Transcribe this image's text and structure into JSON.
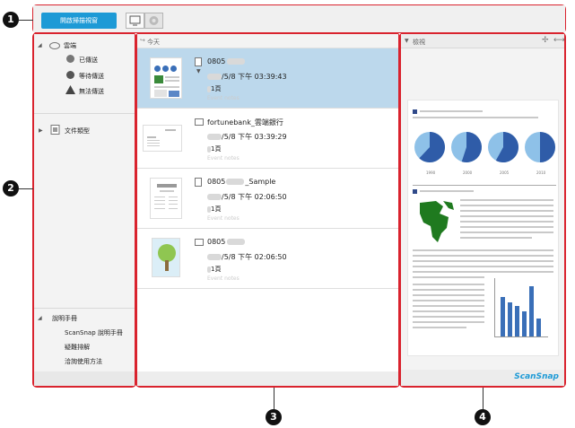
{
  "callouts": [
    "1",
    "2",
    "3",
    "4"
  ],
  "toolbar": {
    "scan_label": "開啟掃描視窗",
    "view_icons": [
      "monitor-icon",
      "cloud-icon"
    ]
  },
  "nav": {
    "cloud": "雲端",
    "sent": "已傳送",
    "waiting": "等待傳送",
    "failed": "無法傳送",
    "doc_types": "文件類型",
    "help": "說明手冊",
    "help_items": [
      "ScanSnap 說明手冊",
      "疑難排解",
      "洽詢使用方法"
    ]
  },
  "list": {
    "group": "今天",
    "items": [
      {
        "name": "0805",
        "date": "/5/8 下午 03:39:43",
        "pages": "1頁",
        "note": "Event notes"
      },
      {
        "name": "fortunebank_雲端銀行",
        "date": "/5/8 下午 03:39:29",
        "pages": "1頁",
        "note": "Event notes"
      },
      {
        "name": "0805",
        "name_suffix": "_Sample",
        "date": "/5/8 下午 02:06:50",
        "pages": "1頁",
        "note": "Event notes"
      },
      {
        "name": "0805",
        "date": "/5/8 下午 02:06:50",
        "pages": "1頁",
        "note": "Event notes"
      }
    ]
  },
  "preview": {
    "title": "檢視",
    "brand": "ScanSnap",
    "pie_labels": [
      "1990",
      "2000",
      "2005",
      "2010"
    ],
    "pie_fractions": [
      0.62,
      0.55,
      0.58,
      0.5
    ]
  },
  "colors": {
    "accent": "#1d9ad6",
    "callout_border": "#d9232e",
    "selected_row": "#bcd8ec"
  }
}
